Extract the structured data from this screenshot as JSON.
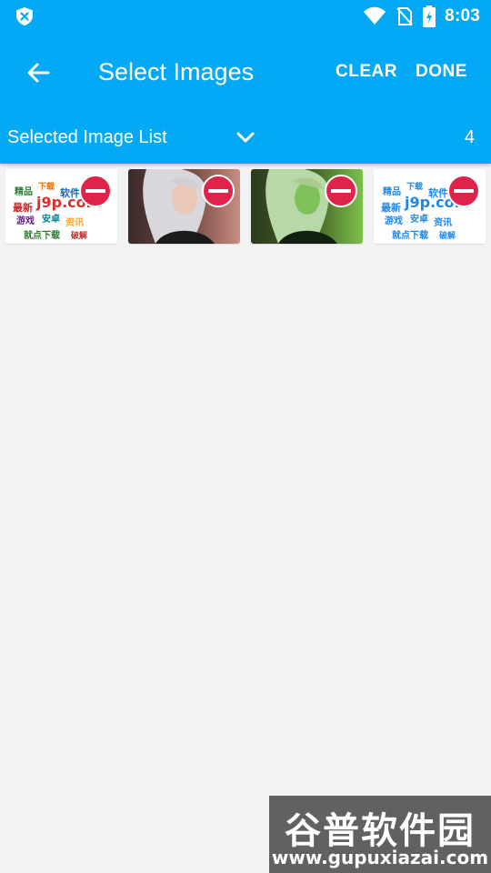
{
  "status_bar": {
    "time": "8:03",
    "icons": [
      "shield-icon",
      "wifi-icon",
      "no-sim-icon",
      "battery-charging-icon"
    ]
  },
  "toolbar": {
    "title": "Select Images",
    "back_icon": "arrow-left-icon",
    "clear_label": "CLEAR",
    "done_label": "DONE"
  },
  "subbar": {
    "label": "Selected Image List",
    "dropdown_icon": "chevron-down-icon",
    "count": "4"
  },
  "images": [
    {
      "kind": "logo",
      "accent": "#d9302a"
    },
    {
      "kind": "portrait",
      "accent": "#c9887a"
    },
    {
      "kind": "portrait-green",
      "accent": "#6fb33a"
    },
    {
      "kind": "logo",
      "accent": "#1e88e5"
    }
  ],
  "colors": {
    "primary": "#03a9f4",
    "remove": "#e0234a",
    "background": "#f2f2f2"
  },
  "watermark": {
    "line1": "谷普软件园",
    "line2": "www.gupuxiazai.com"
  }
}
